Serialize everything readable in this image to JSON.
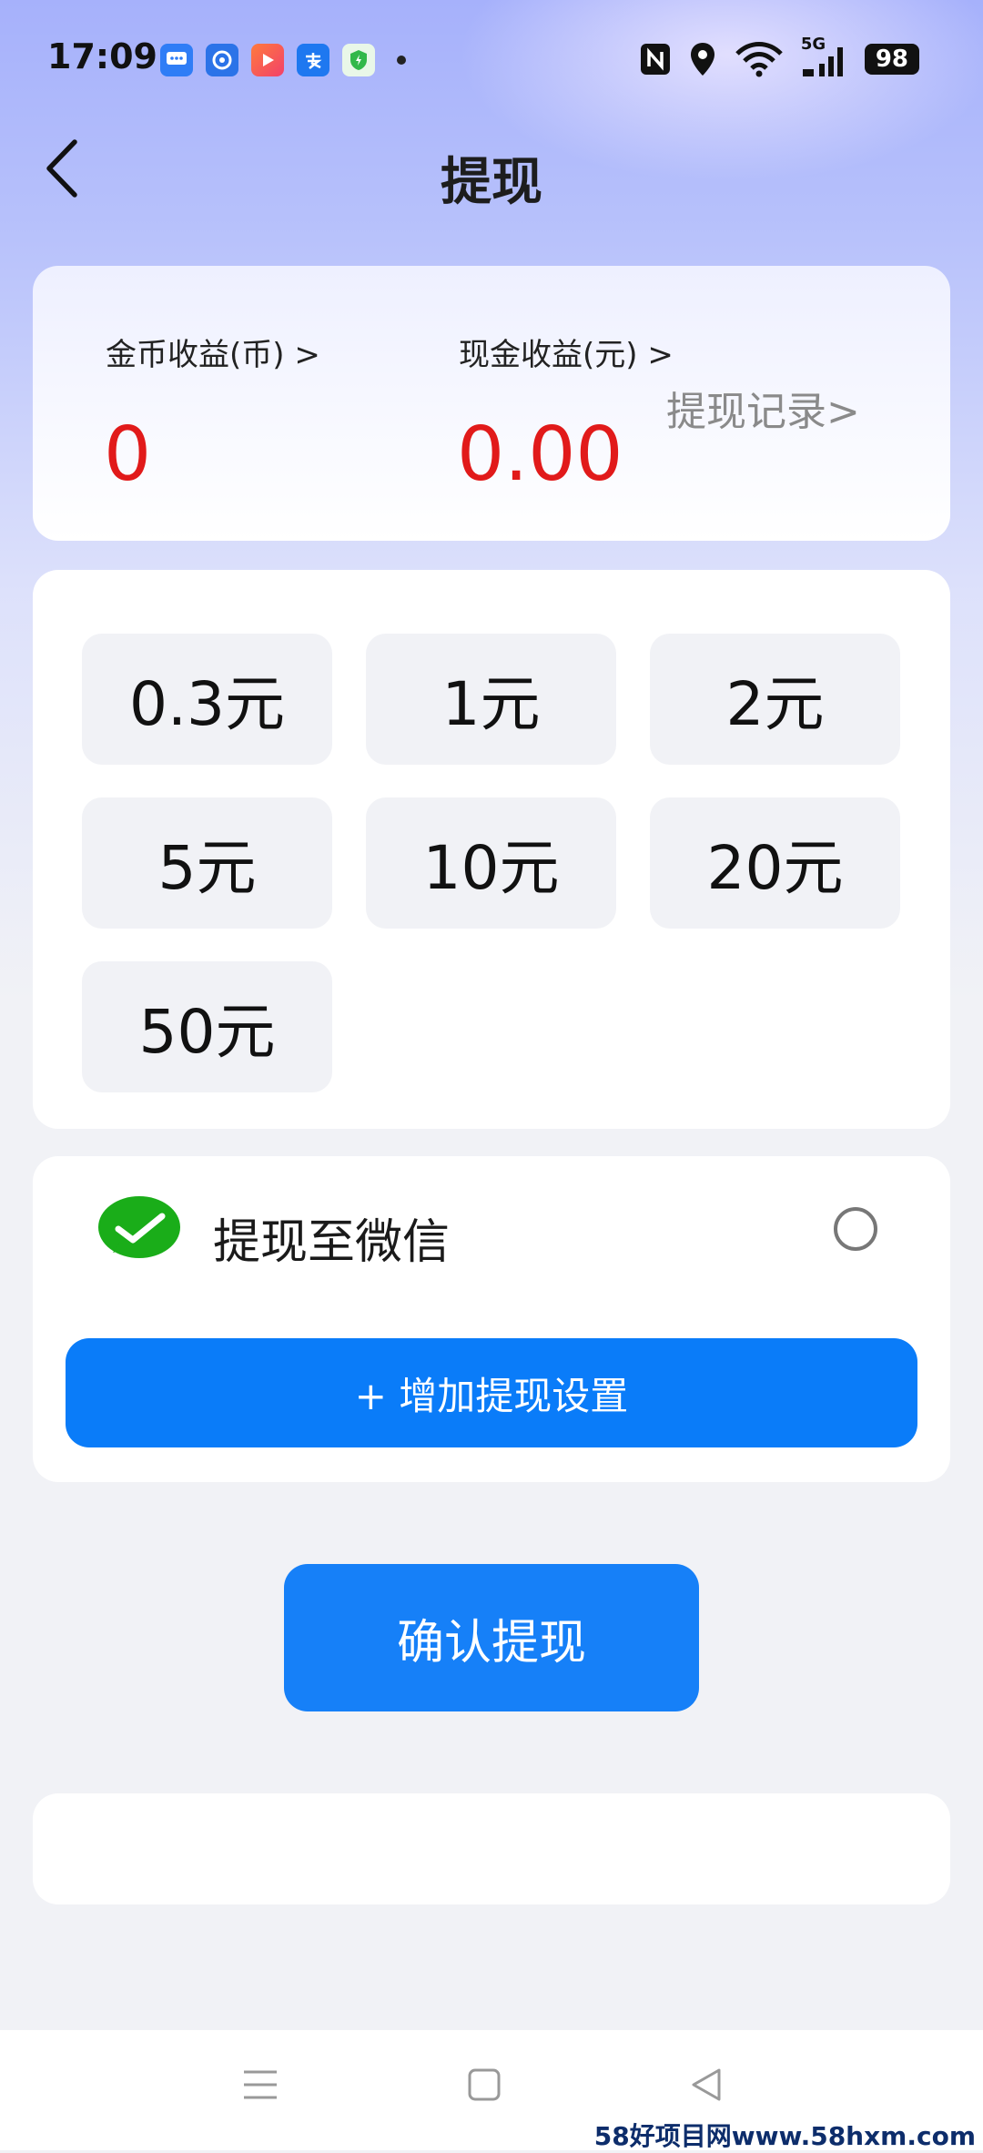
{
  "status_bar": {
    "time": "17:09",
    "battery": "98",
    "network": "5G",
    "app_icons": [
      "message-icon",
      "pinwheel-icon",
      "video-app-icon",
      "alipay-icon",
      "shield-icon"
    ],
    "right_icons": [
      "nfc-icon",
      "location-icon",
      "wifi-icon",
      "signal-icon"
    ]
  },
  "header": {
    "title": "提现",
    "back_icon": "chevron-left-icon"
  },
  "earnings": {
    "coin_label": "金币收益(币) >",
    "coin_value": "0",
    "cash_label": "现金收益(元) >",
    "cash_value": "0.00",
    "record_link": "提现记录>",
    "value_color": "#e11a1a"
  },
  "amounts": [
    "0.3元",
    "1元",
    "2元",
    "5元",
    "10元",
    "20元",
    "50元"
  ],
  "method": {
    "label": "提现至微信",
    "icon": "wechat-icon",
    "selected": false,
    "add_button": "+ 增加提现设置"
  },
  "confirm_button": "确认提现",
  "accent_color": "#1680f8",
  "nav_bar": {
    "icons": [
      "menu-icon",
      "home-square-icon",
      "back-triangle-icon"
    ]
  },
  "watermark": "58好项目网www.58hxm.com"
}
